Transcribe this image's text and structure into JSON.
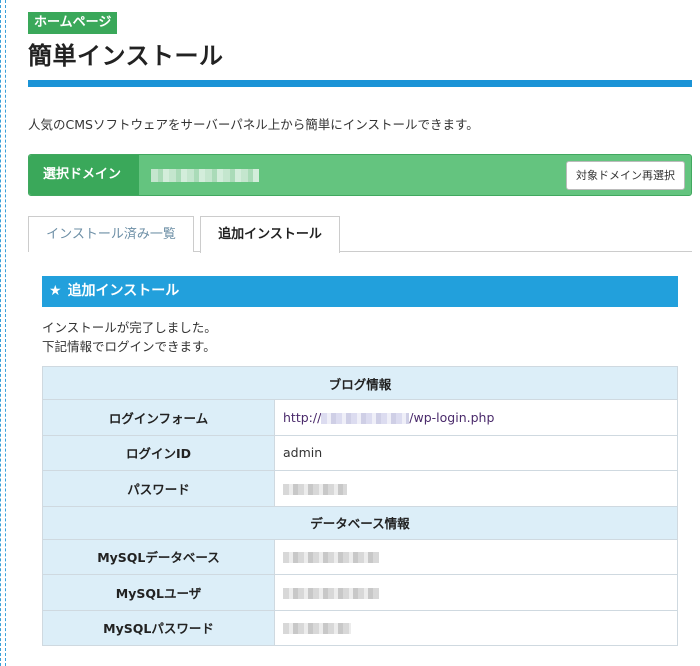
{
  "header": {
    "badge": "ホームページ",
    "title": "簡単インストール",
    "intro": "人気のCMSソフトウェアをサーバーパネル上から簡単にインストールできます。"
  },
  "domain": {
    "label": "選択ドメイン",
    "reselect_button": "対象ドメイン再選択"
  },
  "tabs": [
    {
      "label": "インストール済み一覧",
      "active": false
    },
    {
      "label": "追加インストール",
      "active": true
    }
  ],
  "section": {
    "title": "追加インストール",
    "message_line1": "インストールが完了しました。",
    "message_line2": "下記情報でログインできます。"
  },
  "table": {
    "blog_group": "ブログ情報",
    "login_form_label": "ログインフォーム",
    "login_form_prefix": "http://",
    "login_form_suffix": "/wp-login.php",
    "login_id_label": "ログインID",
    "login_id_value": "admin",
    "password_label": "パスワード",
    "db_group": "データベース情報",
    "mysql_db_label": "MySQLデータベース",
    "mysql_user_label": "MySQLユーザ",
    "mysql_password_label": "MySQLパスワード"
  },
  "colors": {
    "accent_blue": "#1b93d6",
    "domain_green": "#64c47f",
    "badge_green": "#3aa85a",
    "table_header_bg": "#dceef8"
  }
}
